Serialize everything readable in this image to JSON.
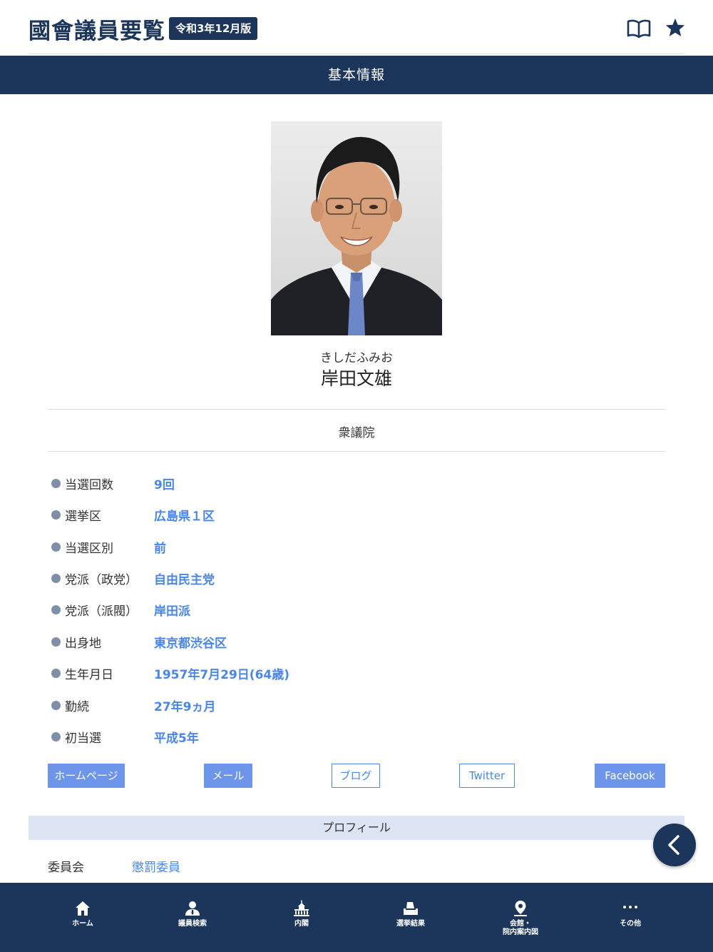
{
  "header": {
    "title": "國會議員要覧",
    "edition": "令和3年12月版"
  },
  "section": {
    "title": "基本情報"
  },
  "member": {
    "furigana": "きしだふみお",
    "name": "岸田文雄",
    "house": "衆議院"
  },
  "info": [
    {
      "label": "当選回数",
      "value": "9回"
    },
    {
      "label": "選挙区",
      "value": "広島県１区"
    },
    {
      "label": "当選区別",
      "value": "前"
    },
    {
      "label": "党派（政党）",
      "value": "自由民主党"
    },
    {
      "label": "党派（派閥）",
      "value": "岸田派"
    },
    {
      "label": "出身地",
      "value": "東京都渋谷区"
    },
    {
      "label": "生年月日",
      "value": "1957年7月29日(64歳)"
    },
    {
      "label": "勤続",
      "value": "27年9ヵ月"
    },
    {
      "label": "初当選",
      "value": "平成5年"
    }
  ],
  "links": {
    "homepage": "ホームページ",
    "mail": "メール",
    "blog": "ブログ",
    "twitter": "Twitter",
    "facebook": "Facebook"
  },
  "profile": {
    "title": "プロフィール",
    "committee_label": "委員会",
    "committee_value": "懲罰委員"
  },
  "nav": {
    "home": "ホーム",
    "member_search": "議員検索",
    "cabinet": "内閣",
    "election_results": "選挙結果",
    "hall_map_line1": "会館・",
    "hall_map_line2": "院内案内図",
    "other": "その他"
  },
  "colors": {
    "navy": "#1b355b",
    "link_blue": "#4a86e8",
    "profile_bar": "#dde5f4"
  }
}
